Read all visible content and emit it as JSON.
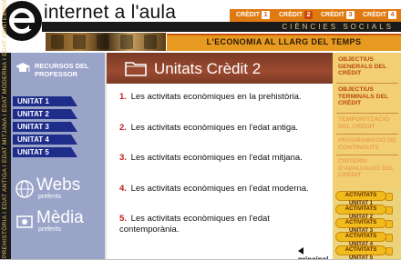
{
  "header": {
    "site_title": "internet a l'aula",
    "subtitle": "CIÈNCIES SOCIALS",
    "banner": "L'ECONOMIA AL LLARG DEL TEMPS",
    "credit_label": "CRÈDIT",
    "credits": [
      "1",
      "2",
      "3",
      "4"
    ],
    "active_credit": "2"
  },
  "vertical_strip": "PREHISTÒRIA I EDAT ANTIGA I EDAT MITJANA I EDAT MODERNA I EDAT CONTEMPORÀNIA",
  "sidebar": {
    "teacher_resources": "RECURSOS DEL PROFESSOR",
    "units": [
      "UNITAT 1",
      "UNITAT 2",
      "UNITAT 3",
      "UNITAT 4",
      "UNITAT 5"
    ],
    "webs": {
      "title": "Webs",
      "subtitle": "preferits"
    },
    "media": {
      "title": "Mèdia",
      "subtitle": "preferits"
    }
  },
  "main": {
    "title": "Unitats Crèdit 2",
    "activities": [
      {
        "num": "1.",
        "text": "Les activitats econòmiques en la prehistòria."
      },
      {
        "num": "2.",
        "text": "Les activitats econòmiques en l'edat antiga."
      },
      {
        "num": "3.",
        "text": "Les activitats econòmiques en l'edat mitjana."
      },
      {
        "num": "4.",
        "text": "Les activitats econòmiques en l'edat moderna."
      },
      {
        "num": "5.",
        "text": "Les activitats econòmiques en l'edat contemporània."
      }
    ],
    "back_link": "principal"
  },
  "right_panel": {
    "links": [
      {
        "label": "OBJECTIUS GENERALS DEL CRÈDIT",
        "state": "active"
      },
      {
        "label": "OBJECTIUS TERMINALS DEL CRÈDIT",
        "state": "active"
      },
      {
        "label": "TEMPORITZACIÓ DEL CRÈDIT",
        "state": "inactive"
      },
      {
        "label": "PROGRAMACIÓ DE CONTINGUTS",
        "state": "inactive"
      },
      {
        "label": "CRITERIS D'AVALUACIÓ DEL CRÈDIT",
        "state": "inactive"
      }
    ],
    "activity_buttons": [
      "ACTIVITATS UNITAT 1",
      "ACTIVITATS UNITAT 2",
      "ACTIVITATS UNITAT 3",
      "ACTIVITATS UNITAT 4",
      "ACTIVITATS UNITAT 5"
    ]
  },
  "colors": {
    "accent_orange": "#e07a10",
    "sidebar_blue": "#9aa3c8",
    "unit_navy": "#1e2c8a",
    "header_brown": "#9c4a30",
    "number_red": "#c02020"
  }
}
